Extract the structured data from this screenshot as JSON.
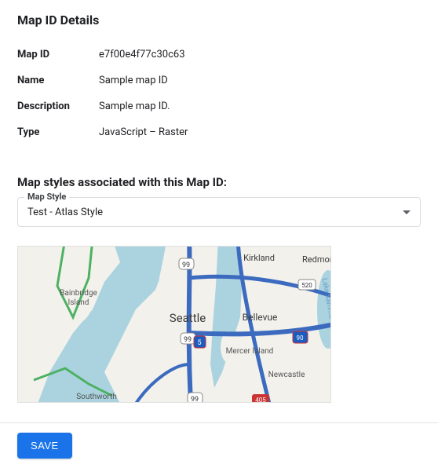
{
  "details": {
    "title": "Map ID Details",
    "rows": [
      {
        "label": "Map ID",
        "value": "e7f00e4f77c30c63"
      },
      {
        "label": "Name",
        "value": "Sample map ID"
      },
      {
        "label": "Description",
        "value": "Sample map ID."
      },
      {
        "label": "Type",
        "value": "JavaScript – Raster"
      }
    ]
  },
  "styles": {
    "title": "Map styles associated with this Map ID:",
    "select_label": "Map Style",
    "selected": "Test - Atlas Style"
  },
  "map": {
    "labels": {
      "seattle": "Seattle",
      "bellevue": "Bellevue",
      "kirkland": "Kirkland",
      "redmond": "Redmond",
      "mercer": "Mercer Island",
      "newcastle": "Newcastle",
      "bainbridge1": "Bainbridge",
      "bainbridge2": "Island",
      "southworth": "Southworth"
    }
  },
  "footer": {
    "save": "SAVE"
  }
}
